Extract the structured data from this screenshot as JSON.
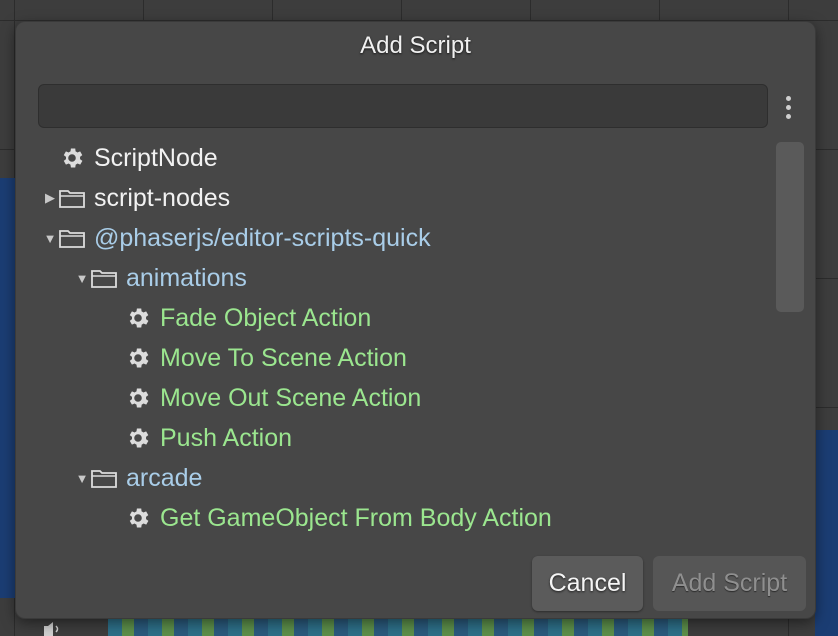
{
  "dialog": {
    "title": "Add Script",
    "filter": {
      "value": "",
      "placeholder": ""
    },
    "menu_icon": "vertical-ellipsis-icon",
    "buttons": {
      "cancel": "Cancel",
      "add_script": "Add Script"
    },
    "add_script_enabled": false
  },
  "tree": {
    "items": [
      {
        "label": "ScriptNode",
        "icon": "gear-icon",
        "toggle": "",
        "color": "#f2f2f2"
      },
      {
        "label": "script-nodes",
        "icon": "folder-icon",
        "toggle": "▶",
        "color": "#f2f2f2"
      },
      {
        "label": "@phaserjs/editor-scripts-quick",
        "icon": "folder-icon",
        "toggle": "▼",
        "color": "#a9cde8"
      },
      {
        "label": "animations",
        "icon": "folder-icon",
        "toggle": "▼",
        "color": "#a9cde8"
      },
      {
        "label": "Fade Object Action",
        "icon": "gear-icon",
        "toggle": "",
        "color": "#9be68f"
      },
      {
        "label": "Move To Scene Action",
        "icon": "gear-icon",
        "toggle": "",
        "color": "#9be68f"
      },
      {
        "label": "Move Out Scene Action",
        "icon": "gear-icon",
        "toggle": "",
        "color": "#9be68f"
      },
      {
        "label": "Push Action",
        "icon": "gear-icon",
        "toggle": "",
        "color": "#9be68f"
      },
      {
        "label": "arcade",
        "icon": "folder-icon",
        "toggle": "▼",
        "color": "#a9cde8"
      },
      {
        "label": "Get GameObject From Body Action",
        "icon": "gear-icon",
        "toggle": "",
        "color": "#9be68f"
      }
    ]
  },
  "colors": {
    "dialog_bg": "#474747",
    "input_bg": "#3a3a3a",
    "script_green": "#9be68f",
    "folder_blue": "#a9cde8",
    "text_white": "#f2f2f2"
  }
}
